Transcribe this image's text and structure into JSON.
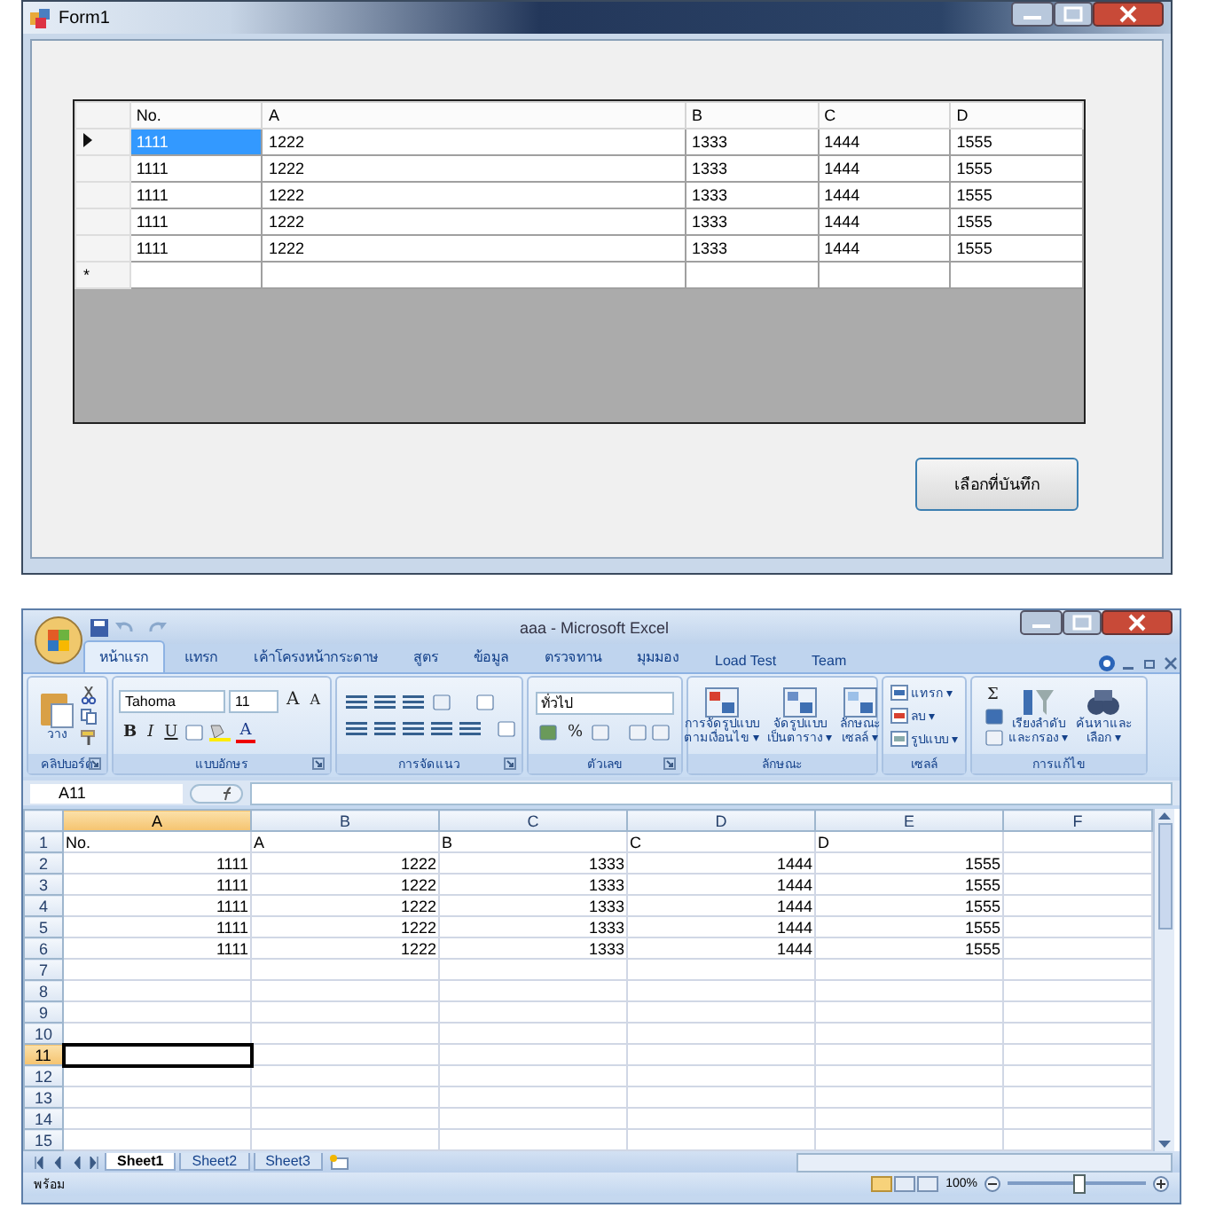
{
  "form": {
    "title": "Form1",
    "grid": {
      "columns": [
        "No.",
        "A",
        "B",
        "C",
        "D"
      ],
      "rows": [
        {
          "selected": true,
          "cells": [
            "1111",
            "1222",
            "1333",
            "1444",
            "1555"
          ]
        },
        {
          "selected": false,
          "cells": [
            "1111",
            "1222",
            "1333",
            "1444",
            "1555"
          ]
        },
        {
          "selected": false,
          "cells": [
            "1111",
            "1222",
            "1333",
            "1444",
            "1555"
          ]
        },
        {
          "selected": false,
          "cells": [
            "1111",
            "1222",
            "1333",
            "1444",
            "1555"
          ]
        },
        {
          "selected": false,
          "cells": [
            "1111",
            "1222",
            "1333",
            "1444",
            "1555"
          ]
        }
      ],
      "new_row": {
        "marker": "*"
      }
    },
    "button": {
      "label": "เลือกที่บันทึก"
    }
  },
  "excel": {
    "title": "aaa - Microsoft Excel",
    "tabs": [
      {
        "label": "หน้าแรก",
        "selected": true
      },
      {
        "label": "แทรก",
        "selected": false
      },
      {
        "label": "เค้าโครงหน้ากระดาษ",
        "selected": false
      },
      {
        "label": "สูตร",
        "selected": false
      },
      {
        "label": "ข้อมูล",
        "selected": false
      },
      {
        "label": "ตรวจทาน",
        "selected": false
      },
      {
        "label": "มุมมอง",
        "selected": false
      },
      {
        "label": "Load Test",
        "selected": false
      },
      {
        "label": "Team",
        "selected": false
      }
    ],
    "ribbon": [
      {
        "kind": "clipboard",
        "label": "คลิปบอร์ด",
        "launcher": true,
        "paste": "วาง"
      },
      {
        "kind": "font",
        "label": "แบบอักษร",
        "launcher": true,
        "font_name": "Tahoma",
        "font_size": "11",
        "size_buttons": [
          "A",
          "A"
        ],
        "style_buttons": [
          "B",
          "I",
          "U"
        ],
        "font_color": "A"
      },
      {
        "kind": "alignment",
        "label": "การจัดแนว",
        "launcher": true
      },
      {
        "kind": "number",
        "label": "ตัวเลข",
        "launcher": true,
        "format": "ทั่วไป",
        "percent": "%"
      },
      {
        "kind": "styles",
        "label": "ลักษณะ",
        "launcher": false,
        "buttons": [
          [
            "การจัดรูปแบบ",
            "ตามเงื่อนไข ▾"
          ],
          [
            "จัดรูปแบบ",
            "เป็นตาราง ▾"
          ],
          [
            "ลักษณะ",
            "เซลล์ ▾"
          ]
        ]
      },
      {
        "kind": "cells",
        "label": "เซลล์",
        "launcher": false,
        "buttons": [
          "แทรก ▾",
          "ลบ ▾",
          "รูปแบบ ▾"
        ]
      },
      {
        "kind": "editing",
        "label": "การแก้ไข",
        "launcher": false,
        "sum": "Σ",
        "buttons": [
          [
            "เรียงลำดับ",
            "และกรอง ▾"
          ],
          [
            "ค้นหาและ",
            "เลือก ▾"
          ]
        ]
      }
    ],
    "name_box": "A11",
    "sheet": {
      "columns": [
        {
          "label": "A",
          "selected": true
        },
        {
          "label": "B",
          "selected": false
        },
        {
          "label": "C",
          "selected": false
        },
        {
          "label": "D",
          "selected": false
        },
        {
          "label": "E",
          "selected": false
        },
        {
          "label": "F",
          "selected": false
        }
      ],
      "rows": [
        {
          "number": "1",
          "selected": false,
          "kind": "text",
          "cells": [
            "No.",
            "A",
            "B",
            "C",
            "D"
          ]
        },
        {
          "number": "2",
          "selected": false,
          "kind": "number",
          "cells": [
            "1111",
            "1222",
            "1333",
            "1444",
            "1555"
          ]
        },
        {
          "number": "3",
          "selected": false,
          "kind": "number",
          "cells": [
            "1111",
            "1222",
            "1333",
            "1444",
            "1555"
          ]
        },
        {
          "number": "4",
          "selected": false,
          "kind": "number",
          "cells": [
            "1111",
            "1222",
            "1333",
            "1444",
            "1555"
          ]
        },
        {
          "number": "5",
          "selected": false,
          "kind": "number",
          "cells": [
            "1111",
            "1222",
            "1333",
            "1444",
            "1555"
          ]
        },
        {
          "number": "6",
          "selected": false,
          "kind": "number",
          "cells": [
            "1111",
            "1222",
            "1333",
            "1444",
            "1555"
          ]
        },
        {
          "number": "7",
          "selected": false,
          "kind": "empty",
          "cells": []
        },
        {
          "number": "8",
          "selected": false,
          "kind": "empty",
          "cells": []
        },
        {
          "number": "9",
          "selected": false,
          "kind": "empty",
          "cells": []
        },
        {
          "number": "10",
          "selected": false,
          "kind": "empty",
          "cells": []
        },
        {
          "number": "11",
          "selected": true,
          "kind": "empty",
          "cells": []
        },
        {
          "number": "12",
          "selected": false,
          "kind": "empty",
          "cells": []
        },
        {
          "number": "13",
          "selected": false,
          "kind": "empty",
          "cells": []
        },
        {
          "number": "14",
          "selected": false,
          "kind": "empty",
          "cells": []
        },
        {
          "number": "15",
          "selected": false,
          "kind": "empty",
          "cells": []
        }
      ]
    },
    "sheet_tabs": [
      {
        "label": "Sheet1",
        "selected": true
      },
      {
        "label": "Sheet2",
        "selected": false
      },
      {
        "label": "Sheet3",
        "selected": false
      }
    ],
    "status": {
      "text": "พร้อม",
      "zoom": "100%",
      "level": 0.5
    }
  }
}
